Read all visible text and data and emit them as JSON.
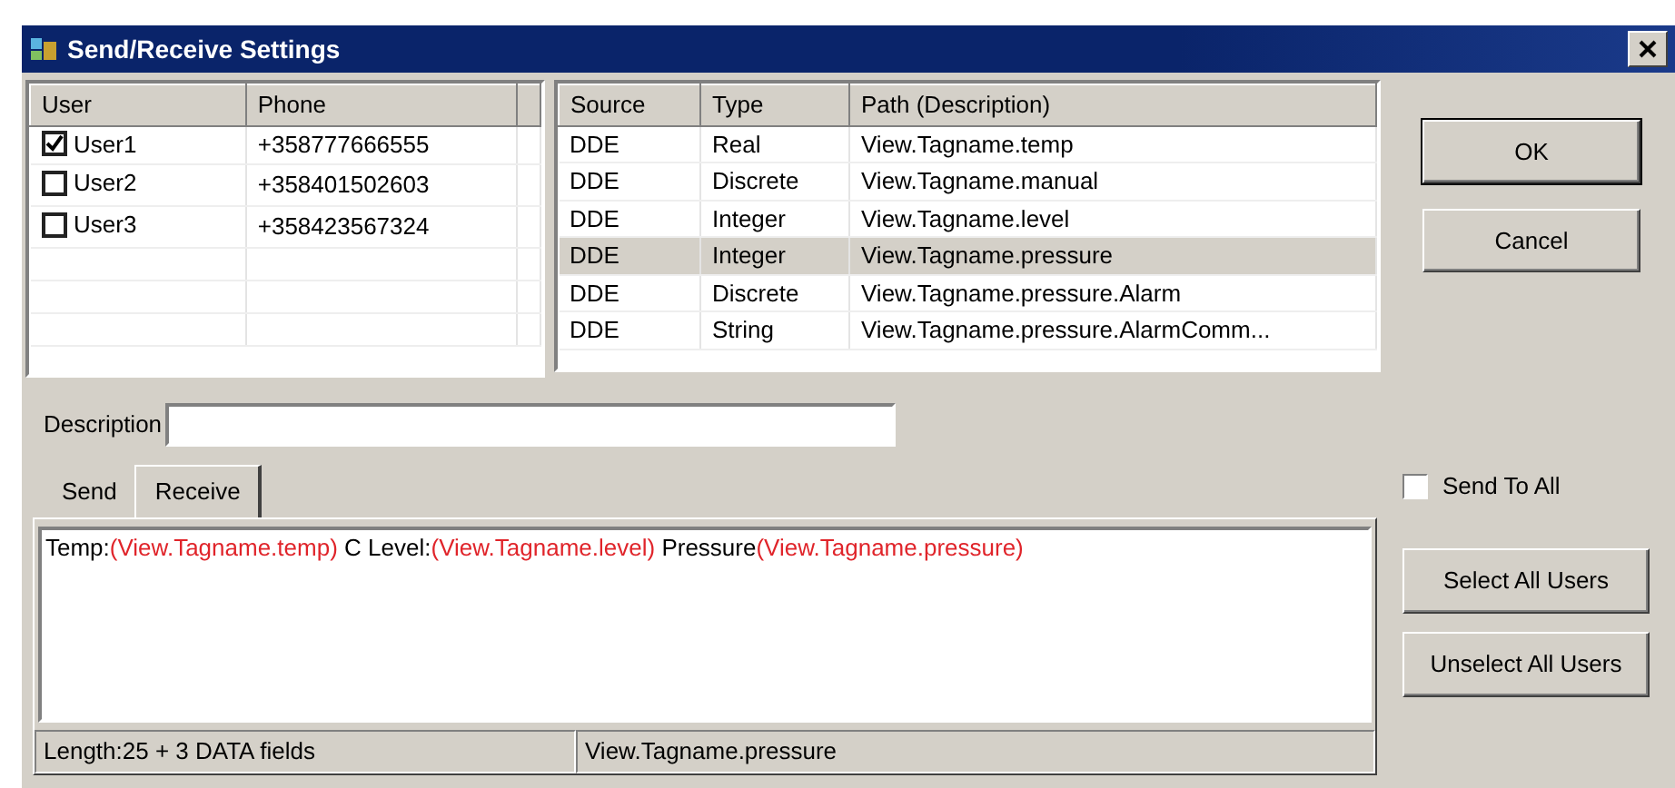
{
  "window": {
    "title": "Send/Receive Settings"
  },
  "users": {
    "columns": [
      "User",
      "Phone"
    ],
    "rows": [
      {
        "name": "User1",
        "phone": "+358777666555",
        "checked": true
      },
      {
        "name": "User2",
        "phone": "+358401502603",
        "checked": false
      },
      {
        "name": "User3",
        "phone": "+358423567324",
        "checked": false
      }
    ]
  },
  "tags": {
    "columns": [
      "Source",
      "Type",
      "Path (Description)"
    ],
    "rows": [
      {
        "source": "DDE",
        "type": "Real",
        "path": "View.Tagname.temp",
        "selected": false
      },
      {
        "source": "DDE",
        "type": "Discrete",
        "path": "View.Tagname.manual",
        "selected": false
      },
      {
        "source": "DDE",
        "type": "Integer",
        "path": "View.Tagname.level",
        "selected": false
      },
      {
        "source": "DDE",
        "type": "Integer",
        "path": "View.Tagname.pressure",
        "selected": true
      },
      {
        "source": "DDE",
        "type": "Discrete",
        "path": "View.Tagname.pressure.Alarm",
        "selected": false
      },
      {
        "source": "DDE",
        "type": "String",
        "path": "View.Tagname.pressure.AlarmComm...",
        "selected": false
      }
    ]
  },
  "buttons": [
    "OK",
    "Cancel"
  ],
  "description": {
    "label": "Description"
  },
  "tabs": [
    {
      "label": "Send",
      "selected": false
    },
    {
      "label": "Receive",
      "selected": true
    }
  ],
  "message": [
    {
      "kind": "text",
      "text": "Temp:"
    },
    {
      "kind": "field",
      "text": "(View.Tagname.temp)"
    },
    {
      "kind": "text",
      "text": "C Level:"
    },
    {
      "kind": "field",
      "text": "(View.Tagname.level)"
    },
    {
      "kind": "text",
      "text": "Pressure"
    },
    {
      "kind": "field",
      "text": "(View.Tagname.pressure)"
    }
  ],
  "status_bar": [
    "Length:25 + 3 DATA fields",
    "View.Tagname.pressure"
  ],
  "send_to_all": {
    "label": "Send To All",
    "checked": false
  },
  "side_buttons": [
    "Select All Users",
    "Unselect All Users"
  ]
}
